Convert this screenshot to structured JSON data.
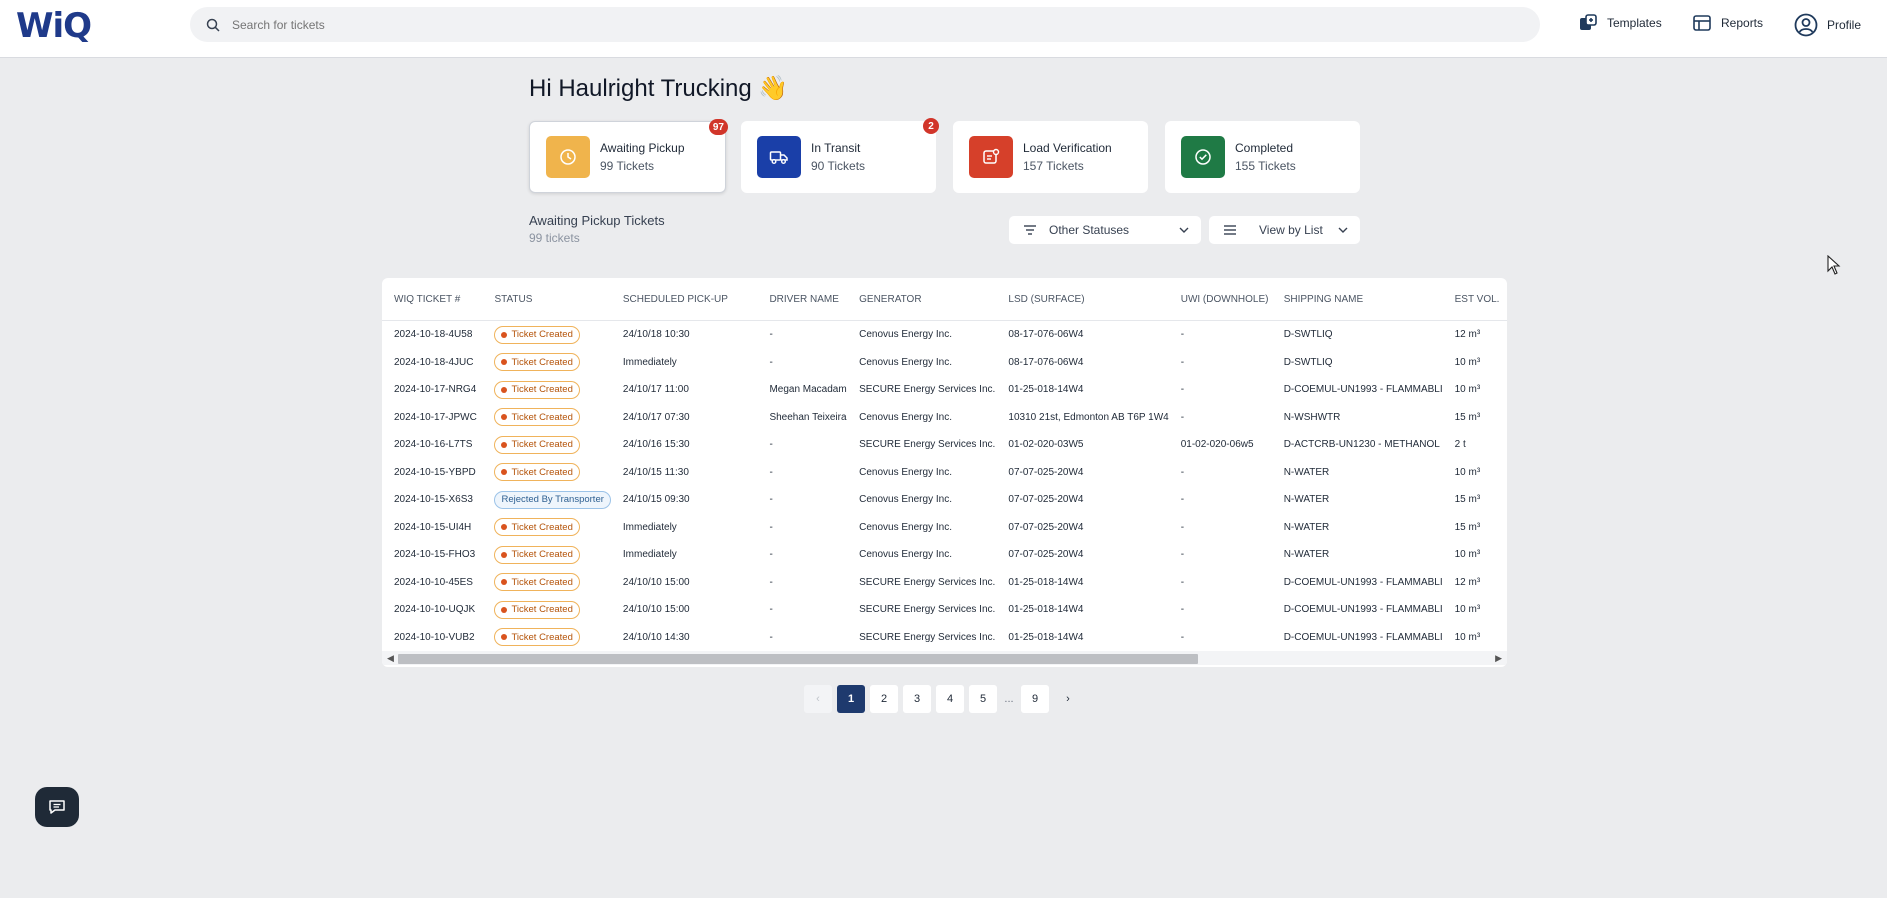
{
  "header": {
    "logo": "WiQ",
    "search_placeholder": "Search for tickets",
    "nav": [
      {
        "label": "Templates",
        "icon": "templates-icon"
      },
      {
        "label": "Reports",
        "icon": "reports-icon"
      },
      {
        "label": "Profile",
        "icon": "profile-icon"
      }
    ]
  },
  "greeting": {
    "text": "Hi Haulright Trucking",
    "emoji": "👋"
  },
  "status_cards": [
    {
      "title": "Awaiting Pickup",
      "count": "99 Tickets",
      "badge": "97",
      "color": "#f0b44c",
      "icon": "clock-icon"
    },
    {
      "title": "In Transit",
      "count": "90 Tickets",
      "badge": "2",
      "color": "#1a3fa8",
      "icon": "truck-icon"
    },
    {
      "title": "Load Verification",
      "count": "157 Tickets",
      "badge": "",
      "color": "#d6402a",
      "icon": "verify-icon"
    },
    {
      "title": "Completed",
      "count": "155 Tickets",
      "badge": "",
      "color": "#1f7a45",
      "icon": "check-icon"
    }
  ],
  "section": {
    "title": "Awaiting Pickup Tickets",
    "subtitle": "99 tickets"
  },
  "filters": {
    "status_label": "Other Statuses",
    "view_label": "View by List"
  },
  "table": {
    "columns": [
      "WIQ TICKET #",
      "STATUS",
      "SCHEDULED PICK-UP",
      "DRIVER NAME",
      "GENERATOR",
      "LSD (SURFACE)",
      "UWI (DOWNHOLE)",
      "SHIPPING NAME",
      "EST VOL."
    ],
    "rows": [
      [
        "2024-10-18-4U58",
        "Ticket Created",
        "24/10/18 10:30",
        "-",
        "Cenovus Energy Inc.",
        "08-17-076-06W4",
        "-",
        "D-SWTLIQ",
        "12 m³"
      ],
      [
        "2024-10-18-4JUC",
        "Ticket Created",
        "Immediately",
        "-",
        "Cenovus Energy Inc.",
        "08-17-076-06W4",
        "-",
        "D-SWTLIQ",
        "10 m³"
      ],
      [
        "2024-10-17-NRG4",
        "Ticket Created",
        "24/10/17 11:00",
        "Megan Macadam",
        "SECURE Energy Services Inc.",
        "01-25-018-14W4",
        "-",
        "D-COEMUL-UN1993 - FLAMMABLI",
        "10 m³"
      ],
      [
        "2024-10-17-JPWC",
        "Ticket Created",
        "24/10/17 07:30",
        "Sheehan Teixeira",
        "Cenovus Energy Inc.",
        "10310 21st, Edmonton AB T6P 1W4",
        "-",
        "N-WSHWTR",
        "15 m³"
      ],
      [
        "2024-10-16-L7TS",
        "Ticket Created",
        "24/10/16 15:30",
        "-",
        "SECURE Energy Services Inc.",
        "01-02-020-03W5",
        "01-02-020-06w5",
        "D-ACTCRB-UN1230 - METHANOL",
        "2 t"
      ],
      [
        "2024-10-15-YBPD",
        "Ticket Created",
        "24/10/15 11:30",
        "-",
        "Cenovus Energy Inc.",
        "07-07-025-20W4",
        "-",
        "N-WATER",
        "10 m³"
      ],
      [
        "2024-10-15-X6S3",
        "Rejected By Transporter",
        "24/10/15 09:30",
        "-",
        "Cenovus Energy Inc.",
        "07-07-025-20W4",
        "-",
        "N-WATER",
        "15 m³"
      ],
      [
        "2024-10-15-UI4H",
        "Ticket Created",
        "Immediately",
        "-",
        "Cenovus Energy Inc.",
        "07-07-025-20W4",
        "-",
        "N-WATER",
        "15 m³"
      ],
      [
        "2024-10-15-FHO3",
        "Ticket Created",
        "Immediately",
        "-",
        "Cenovus Energy Inc.",
        "07-07-025-20W4",
        "-",
        "N-WATER",
        "10 m³"
      ],
      [
        "2024-10-10-45ES",
        "Ticket Created",
        "24/10/10 15:00",
        "-",
        "SECURE Energy Services Inc.",
        "01-25-018-14W4",
        "-",
        "D-COEMUL-UN1993 - FLAMMABLI",
        "12 m³"
      ],
      [
        "2024-10-10-UQJK",
        "Ticket Created",
        "24/10/10 15:00",
        "-",
        "SECURE Energy Services Inc.",
        "01-25-018-14W4",
        "-",
        "D-COEMUL-UN1993 - FLAMMABLI",
        "10 m³"
      ],
      [
        "2024-10-10-VUB2",
        "Ticket Created",
        "24/10/10 14:30",
        "-",
        "SECURE Energy Services Inc.",
        "01-25-018-14W4",
        "-",
        "D-COEMUL-UN1993 - FLAMMABLI",
        "10 m³"
      ]
    ]
  },
  "pagination": {
    "pages": [
      "1",
      "2",
      "3",
      "4",
      "5"
    ],
    "ellipsis": "...",
    "last": "9",
    "current": "1",
    "prev": "‹",
    "next": "›"
  }
}
